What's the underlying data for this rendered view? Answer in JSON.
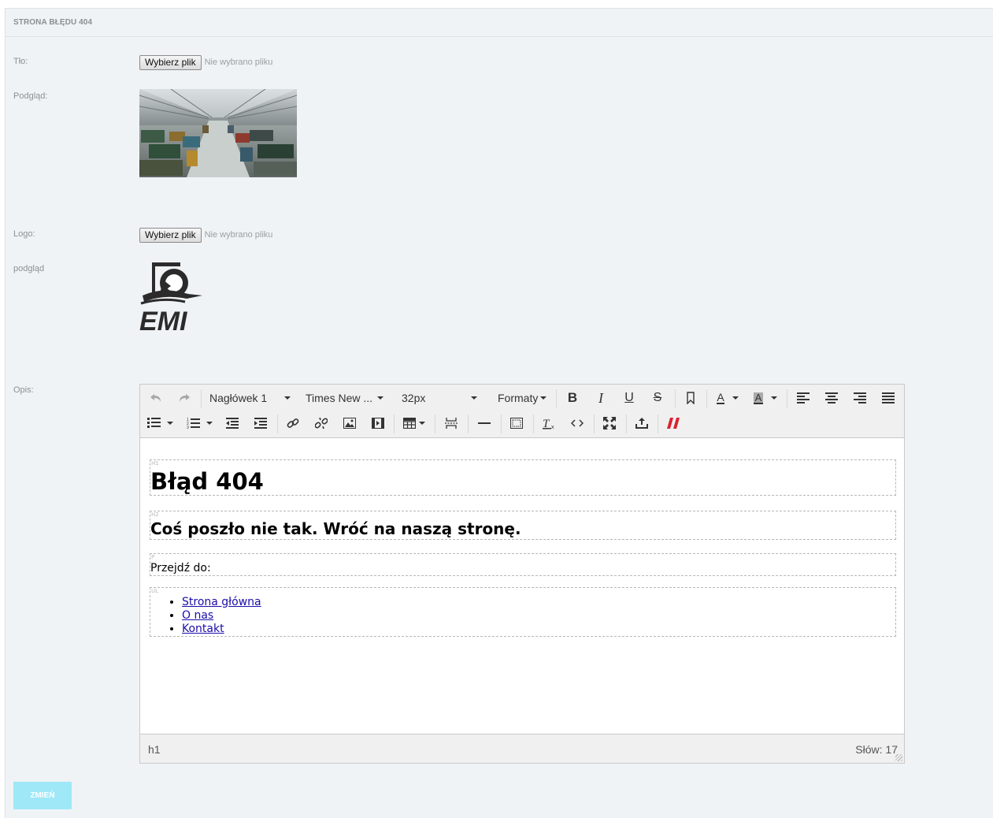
{
  "panel": {
    "title": "STRONA BŁĘDU 404"
  },
  "background_field": {
    "label": "Tło:",
    "button": "Wybierz plik",
    "status": "Nie wybrano pliku"
  },
  "preview_field": {
    "label": "Podgląd:"
  },
  "logo_field": {
    "label": "Logo:",
    "button": "Wybierz plik",
    "status": "Nie wybrano pliku"
  },
  "logo_preview_field": {
    "label": "podgląd",
    "logo_text": "EMI"
  },
  "description_field": {
    "label": "Opis:"
  },
  "editor": {
    "toolbar": {
      "block_format": "Nagłówek 1",
      "font_family": "Times New ...",
      "font_size": "32px",
      "formats": "Formaty"
    },
    "content": {
      "h1": "Błąd 404",
      "h2": "Coś poszło nie tak. Wróć na naszą stronę.",
      "p": "Przejdź do:",
      "links": [
        "Strona główna",
        "O nas",
        "Kontakt"
      ],
      "block_tags": {
        "h1": "H1",
        "h2": "H2",
        "p": "P",
        "ul": "UL"
      }
    },
    "statusbar": {
      "path": "h1",
      "word_count": "Słów: 17"
    }
  },
  "submit_button": {
    "label": "ZMIEŃ"
  },
  "colors": {
    "panel_bg": "#f0f3f6",
    "submit_bg": "#9ee8f7",
    "link": "#1a0dab",
    "remove_format_red": "#d9232e"
  }
}
